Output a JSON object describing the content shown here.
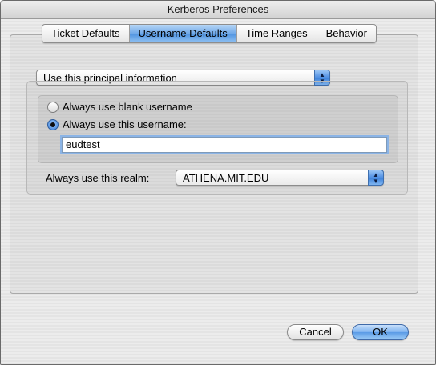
{
  "window": {
    "title": "Kerberos Preferences"
  },
  "tabs": [
    {
      "label": "Ticket Defaults",
      "selected": false
    },
    {
      "label": "Username Defaults",
      "selected": true
    },
    {
      "label": "Time Ranges",
      "selected": false
    },
    {
      "label": "Behavior",
      "selected": false
    }
  ],
  "principal_popup": {
    "value": "Use this principal information"
  },
  "username_options": {
    "blank_label": "Always use blank username",
    "blank_checked": false,
    "this_label": "Always use this username:",
    "this_checked": true,
    "username_value": "eudtest"
  },
  "realm": {
    "label": "Always use this realm:",
    "value": "ATHENA.MIT.EDU"
  },
  "buttons": {
    "cancel": "Cancel",
    "ok": "OK"
  },
  "colors": {
    "accent": "#5a9ae6",
    "window_bg": "#e6e6e6"
  }
}
